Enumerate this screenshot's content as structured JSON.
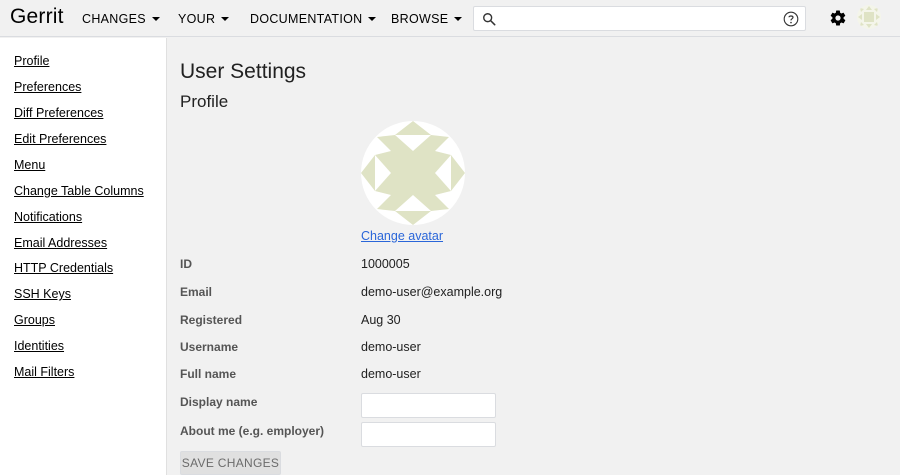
{
  "header": {
    "logo": "Gerrit",
    "nav": [
      {
        "label": "CHANGES"
      },
      {
        "label": "YOUR"
      },
      {
        "label": "DOCUMENTATION"
      },
      {
        "label": "BROWSE"
      }
    ],
    "search": {
      "value": "",
      "placeholder": ""
    },
    "icons": {
      "search": "search-icon",
      "help": "help-icon",
      "settings": "gear-icon",
      "avatar": "avatar"
    }
  },
  "sidebar": {
    "items": [
      {
        "label": "Profile"
      },
      {
        "label": "Preferences"
      },
      {
        "label": "Diff Preferences"
      },
      {
        "label": "Edit Preferences"
      },
      {
        "label": "Menu"
      },
      {
        "label": "Change Table Columns"
      },
      {
        "label": "Notifications"
      },
      {
        "label": "Email Addresses"
      },
      {
        "label": "HTTP Credentials"
      },
      {
        "label": "SSH Keys"
      },
      {
        "label": "Groups"
      },
      {
        "label": "Identities"
      },
      {
        "label": "Mail Filters"
      }
    ]
  },
  "main": {
    "title": "User Settings",
    "section": "Profile",
    "change_avatar": "Change avatar",
    "fields": [
      {
        "label": "ID",
        "value": "1000005"
      },
      {
        "label": "Email",
        "value": "demo-user@example.org"
      },
      {
        "label": "Registered",
        "value": "Aug 30"
      },
      {
        "label": "Username",
        "value": "demo-user"
      },
      {
        "label": "Full name",
        "value": "demo-user"
      }
    ],
    "display_name": {
      "label": "Display name",
      "value": ""
    },
    "about_me": {
      "label": "About me (e.g. employer)",
      "value": ""
    },
    "save_button": "SAVE CHANGES"
  },
  "colors": {
    "link": "#2a66d9",
    "avatar_fill": "#dfe3c5",
    "background": "#f1f1f1",
    "sidebar": "#ffffff"
  }
}
